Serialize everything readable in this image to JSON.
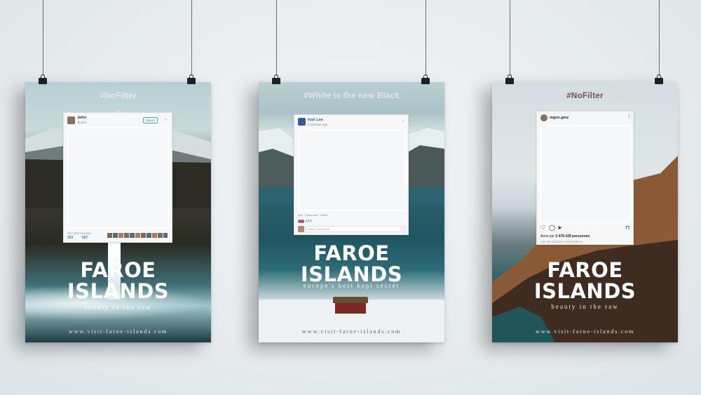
{
  "posters": [
    {
      "hashtag": "#NoFilter",
      "title_line1": "FAROE",
      "title_line2": "ISLANDS",
      "tagline": "beauty in the raw",
      "url": "www.visit-faroe-islands.com",
      "card": {
        "username": "John",
        "handle": "@john",
        "follow_label": "Suivre",
        "retweets_label": "RETWEETS",
        "retweets_value": "293",
        "likes_label": "J'AIME",
        "likes_value": "587"
      }
    },
    {
      "hashtag": "#White is the new Black",
      "title_line1": "FAROE",
      "title_line2": "ISLANDS",
      "tagline": "europe's best kept secret",
      "url": "www.visit-faroe-islands.com",
      "card": {
        "username": "Karl Lee",
        "time": "5 minutes ago",
        "actions": "Like · Comment · Share",
        "reactions": "12 K",
        "comment_placeholder": "Write a comment..."
      }
    },
    {
      "hashtag": "#NoFilter",
      "title_line1": "FAROE",
      "title_line2": "ISLANDS",
      "tagline": "beauty in the raw",
      "url": "www.visit-faroe-islands.com",
      "card": {
        "username": "mgxn.gmz",
        "likes_prefix": "Aimé par ",
        "likes_value": "3 478 428 personnes",
        "comments": "Voir les 632245 commentaires"
      }
    }
  ],
  "colors": {
    "wall": "#e9edf0",
    "twitter_blue": "#2f8fd6",
    "facebook_blue": "#3b5998",
    "instagram_text": "#262626"
  },
  "icons": [
    "binder-clip-icon",
    "chevron-down-icon",
    "heart-icon",
    "comment-icon",
    "send-icon",
    "bookmark-icon",
    "more-icon",
    "camera-icon"
  ]
}
